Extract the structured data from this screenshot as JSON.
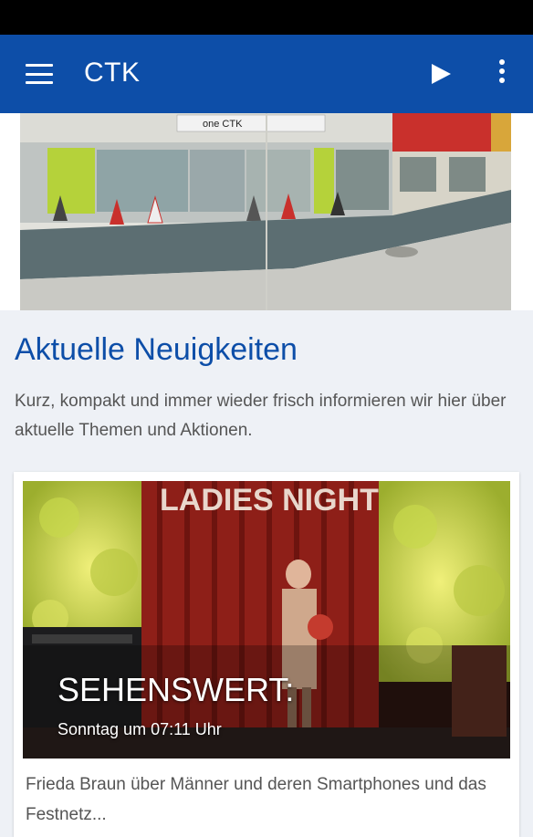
{
  "app_bar": {
    "title": "CTK",
    "menu_icon": "hamburger-menu-icon",
    "play_icon": "play-icon",
    "more_icon": "more-vert-icon",
    "color": "#0d4ea8"
  },
  "hero": {
    "image": "storefront street photo",
    "sign_text": "one CTK"
  },
  "news": {
    "heading": "Aktuelle Neuigkeiten",
    "intro": "Kurz, kompakt und immer wieder frisch informieren wir hier über aktuelle Themen und Aktionen."
  },
  "card": {
    "image_text": "LADIES NIGHT",
    "overlay_title": "SEHENSWERT:",
    "overlay_time": "Sonntag um 07:11 Uhr",
    "text": "Frieda Braun über Männer und deren Smartphones und das Festnetz..."
  }
}
